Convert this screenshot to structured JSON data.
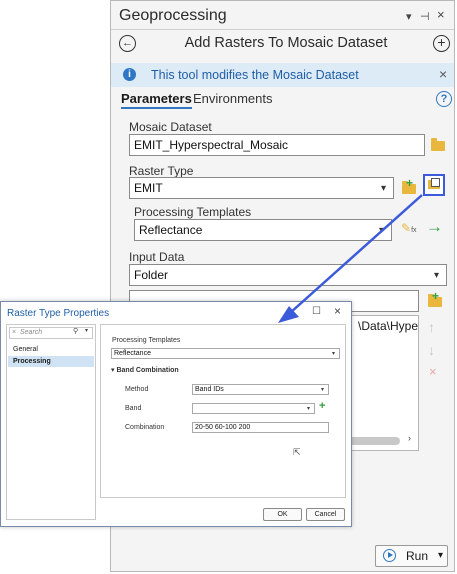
{
  "gp": {
    "title": "Geoprocessing",
    "tool_name": "Add Rasters To Mosaic Dataset",
    "info": "This tool modifies the Mosaic Dataset",
    "tabs": [
      "Parameters",
      "Environments"
    ],
    "mosaic_dataset_label": "Mosaic Dataset",
    "mosaic_dataset_value": "EMIT_Hyperspectral_Mosaic",
    "raster_type_label": "Raster Type",
    "raster_type_value": "EMIT",
    "processing_templates_label": "Processing Templates",
    "processing_templates_value": "Reflectance",
    "input_data_label": "Input Data",
    "input_data_value": "Folder",
    "path_value": "\\Data\\Hypers",
    "run_label": "Run"
  },
  "rtp": {
    "title": "Raster Type Properties",
    "search_placeholder": "Search",
    "nav": [
      "General",
      "Processing"
    ],
    "proc_templates_label": "Processing Templates",
    "proc_templates_value": "Reflectance",
    "band_combination_label": "Band Combination",
    "method_label": "Method",
    "method_value": "Band IDs",
    "band_label": "Band",
    "band_value": "",
    "combination_label": "Combination",
    "combination_value": "20-50 60-100 200",
    "ok_label": "OK",
    "cancel_label": "Cancel"
  },
  "colors": {
    "accent": "#2f77c5",
    "highlight": "#3b5bdb",
    "selected_nav": "#cfe3f5",
    "info_bg": "#ddebf7"
  }
}
